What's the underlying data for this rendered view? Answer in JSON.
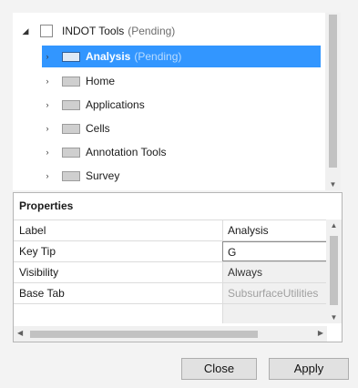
{
  "tree": {
    "root": {
      "label": "INDOT Tools",
      "status": "(Pending)",
      "expander": "◢",
      "icon": "root-ribbon-icon"
    },
    "items": [
      {
        "label": "Analysis",
        "status": "(Pending)",
        "selected": true,
        "expander": "›",
        "icon": "tab-icon"
      },
      {
        "label": "Home",
        "status": "",
        "expander": "›",
        "icon": "tab-icon"
      },
      {
        "label": "Applications",
        "status": "",
        "expander": "›",
        "icon": "tab-icon"
      },
      {
        "label": "Cells",
        "status": "",
        "expander": "›",
        "icon": "tab-icon"
      },
      {
        "label": "Annotation Tools",
        "status": "",
        "expander": "›",
        "icon": "tab-icon"
      },
      {
        "label": "Survey",
        "status": "",
        "expander": "›",
        "icon": "tab-icon"
      }
    ]
  },
  "properties": {
    "title": "Properties",
    "rows": [
      {
        "name": "Label",
        "value": "Analysis"
      },
      {
        "name": "Key Tip",
        "value": "G"
      },
      {
        "name": "Visibility",
        "value": "Always"
      },
      {
        "name": "Base Tab",
        "value": "SubsurfaceUtilities"
      }
    ]
  },
  "scroll": {
    "up": "▲",
    "down": "▼",
    "left": "◀",
    "right": "▶"
  },
  "buttons": {
    "close": "Close",
    "apply": "Apply"
  },
  "colors": {
    "selection": "#3296ff",
    "background": "#f3f3f3"
  }
}
